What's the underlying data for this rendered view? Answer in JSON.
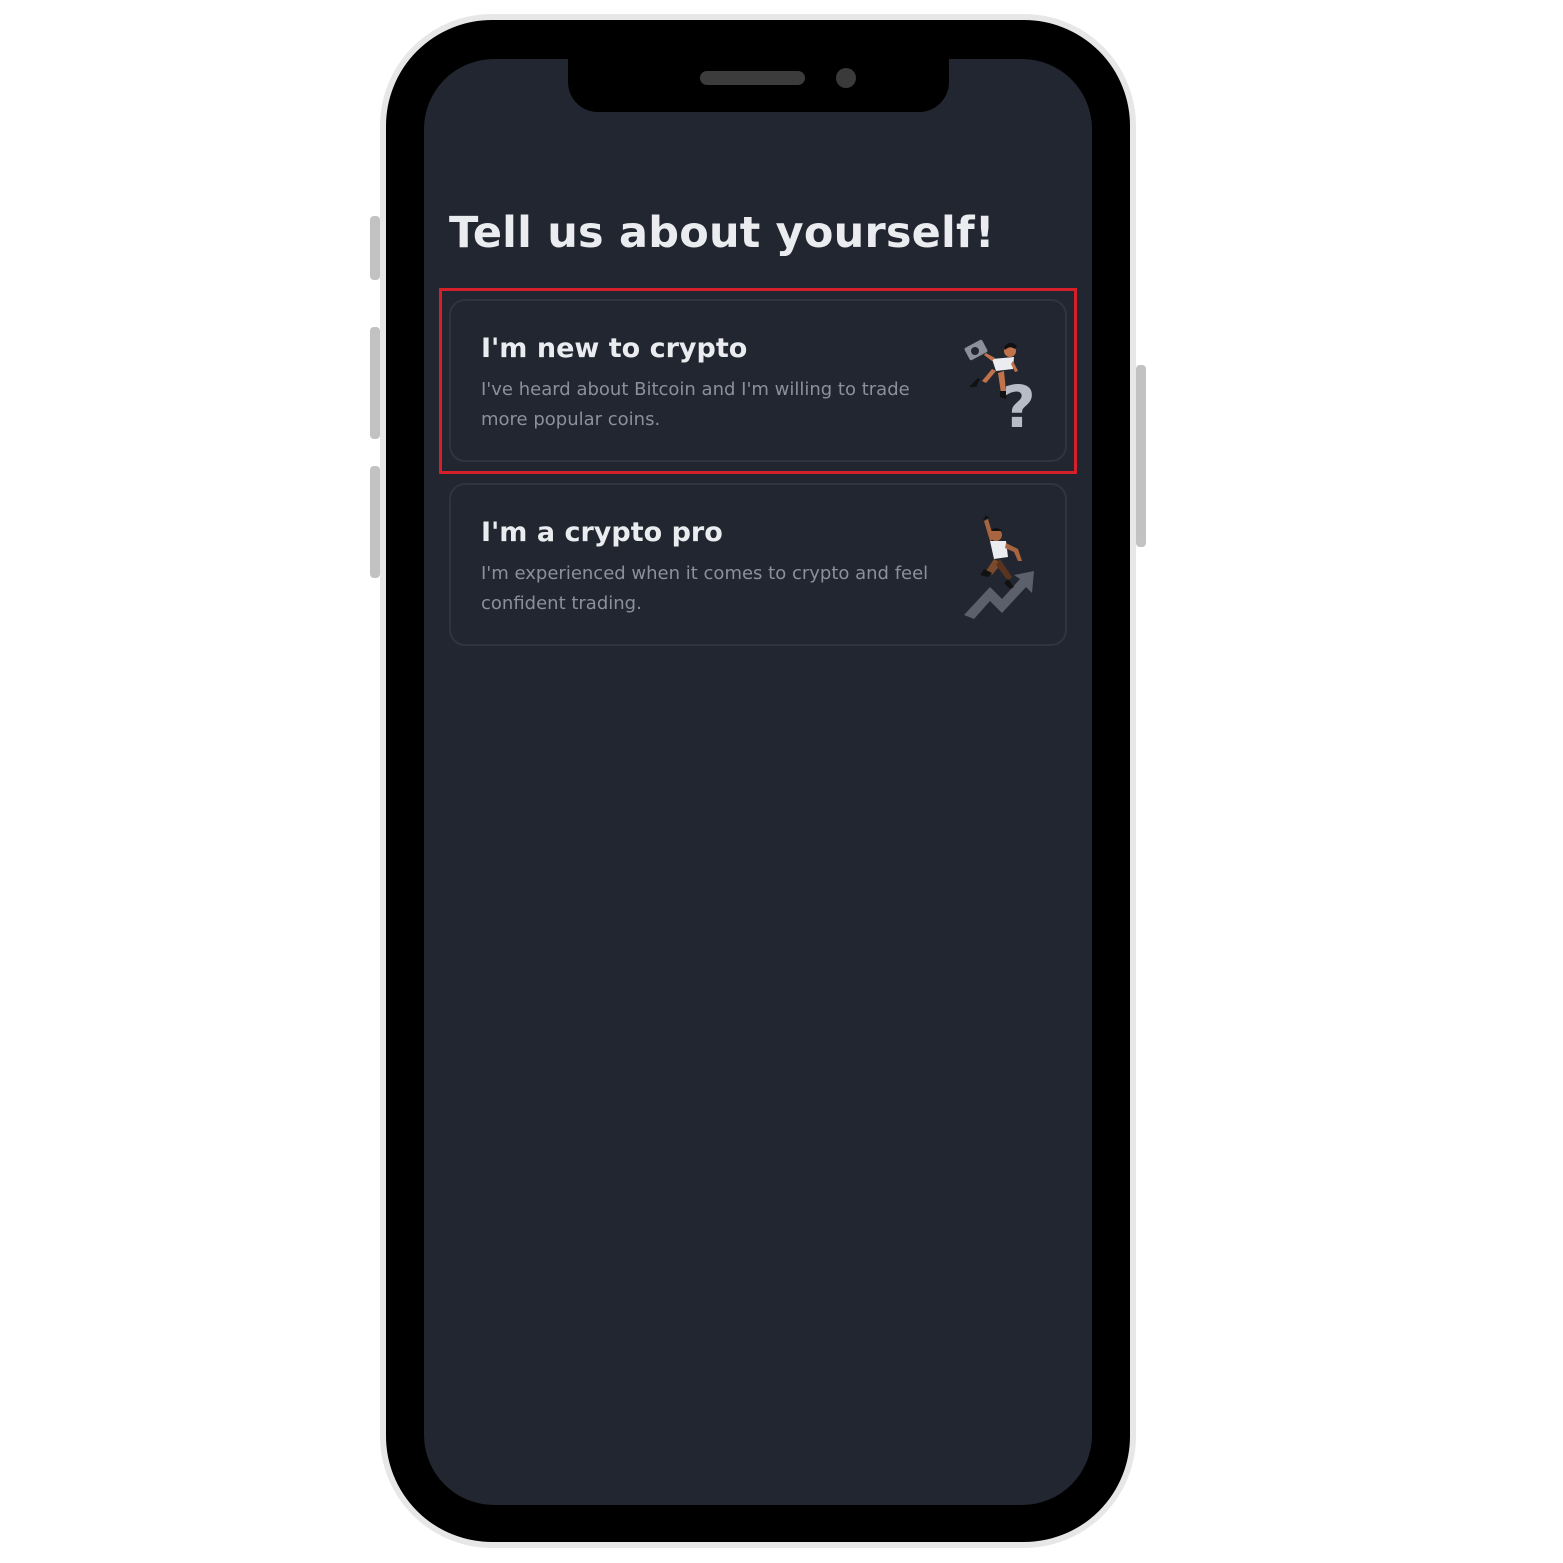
{
  "page": {
    "title": "Tell us about yourself!"
  },
  "options": [
    {
      "title": "I'm new to crypto",
      "description": "I've heard about Bitcoin and I'm willing to trade more popular coins.",
      "icon": "question-mark-person-illustration"
    },
    {
      "title": "I'm a crypto pro",
      "description": "I'm experienced when it comes to crypto and feel confident trading.",
      "icon": "rising-arrow-person-illustration"
    }
  ],
  "colors": {
    "background": "#222630",
    "title_text": "#eaecef",
    "secondary_text": "#8b909b",
    "card_border": "#2f3440",
    "highlight": "#d3202a"
  }
}
